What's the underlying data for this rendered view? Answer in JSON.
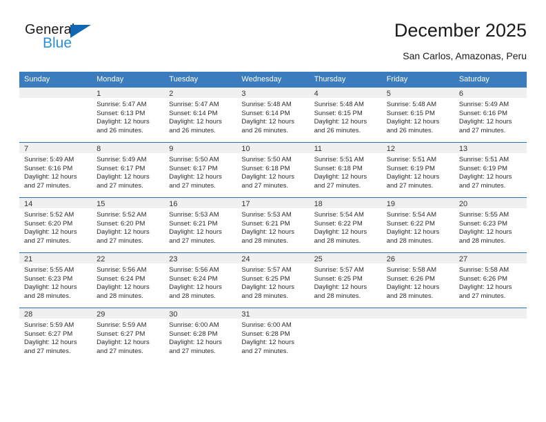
{
  "brand": {
    "name_top": "General",
    "name_bottom": "Blue",
    "triangle_color": "#1267b2",
    "blue_text_color": "#2a8fd4"
  },
  "header": {
    "title": "December 2025",
    "subtitle": "San Carlos, Amazonas, Peru"
  },
  "theme": {
    "header_bg": "#3a7cbe",
    "header_text": "#ffffff",
    "daynum_band_bg": "#f0f0f0",
    "row_divider": "#2c6ca8"
  },
  "weekday_headers": [
    "Sunday",
    "Monday",
    "Tuesday",
    "Wednesday",
    "Thursday",
    "Friday",
    "Saturday"
  ],
  "labels": {
    "sunrise_prefix": "Sunrise:",
    "sunset_prefix": "Sunset:",
    "daylight_prefix": "Daylight:"
  },
  "weeks": [
    [
      {
        "day": "",
        "empty": true,
        "line1": "",
        "line2": "",
        "line3": "",
        "line4": ""
      },
      {
        "day": "1",
        "empty": false,
        "line1": "Sunrise: 5:47 AM",
        "line2": "Sunset: 6:13 PM",
        "line3": "Daylight: 12 hours",
        "line4": "and 26 minutes."
      },
      {
        "day": "2",
        "empty": false,
        "line1": "Sunrise: 5:47 AM",
        "line2": "Sunset: 6:14 PM",
        "line3": "Daylight: 12 hours",
        "line4": "and 26 minutes."
      },
      {
        "day": "3",
        "empty": false,
        "line1": "Sunrise: 5:48 AM",
        "line2": "Sunset: 6:14 PM",
        "line3": "Daylight: 12 hours",
        "line4": "and 26 minutes."
      },
      {
        "day": "4",
        "empty": false,
        "line1": "Sunrise: 5:48 AM",
        "line2": "Sunset: 6:15 PM",
        "line3": "Daylight: 12 hours",
        "line4": "and 26 minutes."
      },
      {
        "day": "5",
        "empty": false,
        "line1": "Sunrise: 5:48 AM",
        "line2": "Sunset: 6:15 PM",
        "line3": "Daylight: 12 hours",
        "line4": "and 26 minutes."
      },
      {
        "day": "6",
        "empty": false,
        "line1": "Sunrise: 5:49 AM",
        "line2": "Sunset: 6:16 PM",
        "line3": "Daylight: 12 hours",
        "line4": "and 27 minutes."
      }
    ],
    [
      {
        "day": "7",
        "empty": false,
        "line1": "Sunrise: 5:49 AM",
        "line2": "Sunset: 6:16 PM",
        "line3": "Daylight: 12 hours",
        "line4": "and 27 minutes."
      },
      {
        "day": "8",
        "empty": false,
        "line1": "Sunrise: 5:49 AM",
        "line2": "Sunset: 6:17 PM",
        "line3": "Daylight: 12 hours",
        "line4": "and 27 minutes."
      },
      {
        "day": "9",
        "empty": false,
        "line1": "Sunrise: 5:50 AM",
        "line2": "Sunset: 6:17 PM",
        "line3": "Daylight: 12 hours",
        "line4": "and 27 minutes."
      },
      {
        "day": "10",
        "empty": false,
        "line1": "Sunrise: 5:50 AM",
        "line2": "Sunset: 6:18 PM",
        "line3": "Daylight: 12 hours",
        "line4": "and 27 minutes."
      },
      {
        "day": "11",
        "empty": false,
        "line1": "Sunrise: 5:51 AM",
        "line2": "Sunset: 6:18 PM",
        "line3": "Daylight: 12 hours",
        "line4": "and 27 minutes."
      },
      {
        "day": "12",
        "empty": false,
        "line1": "Sunrise: 5:51 AM",
        "line2": "Sunset: 6:19 PM",
        "line3": "Daylight: 12 hours",
        "line4": "and 27 minutes."
      },
      {
        "day": "13",
        "empty": false,
        "line1": "Sunrise: 5:51 AM",
        "line2": "Sunset: 6:19 PM",
        "line3": "Daylight: 12 hours",
        "line4": "and 27 minutes."
      }
    ],
    [
      {
        "day": "14",
        "empty": false,
        "line1": "Sunrise: 5:52 AM",
        "line2": "Sunset: 6:20 PM",
        "line3": "Daylight: 12 hours",
        "line4": "and 27 minutes."
      },
      {
        "day": "15",
        "empty": false,
        "line1": "Sunrise: 5:52 AM",
        "line2": "Sunset: 6:20 PM",
        "line3": "Daylight: 12 hours",
        "line4": "and 27 minutes."
      },
      {
        "day": "16",
        "empty": false,
        "line1": "Sunrise: 5:53 AM",
        "line2": "Sunset: 6:21 PM",
        "line3": "Daylight: 12 hours",
        "line4": "and 27 minutes."
      },
      {
        "day": "17",
        "empty": false,
        "line1": "Sunrise: 5:53 AM",
        "line2": "Sunset: 6:21 PM",
        "line3": "Daylight: 12 hours",
        "line4": "and 28 minutes."
      },
      {
        "day": "18",
        "empty": false,
        "line1": "Sunrise: 5:54 AM",
        "line2": "Sunset: 6:22 PM",
        "line3": "Daylight: 12 hours",
        "line4": "and 28 minutes."
      },
      {
        "day": "19",
        "empty": false,
        "line1": "Sunrise: 5:54 AM",
        "line2": "Sunset: 6:22 PM",
        "line3": "Daylight: 12 hours",
        "line4": "and 28 minutes."
      },
      {
        "day": "20",
        "empty": false,
        "line1": "Sunrise: 5:55 AM",
        "line2": "Sunset: 6:23 PM",
        "line3": "Daylight: 12 hours",
        "line4": "and 28 minutes."
      }
    ],
    [
      {
        "day": "21",
        "empty": false,
        "line1": "Sunrise: 5:55 AM",
        "line2": "Sunset: 6:23 PM",
        "line3": "Daylight: 12 hours",
        "line4": "and 28 minutes."
      },
      {
        "day": "22",
        "empty": false,
        "line1": "Sunrise: 5:56 AM",
        "line2": "Sunset: 6:24 PM",
        "line3": "Daylight: 12 hours",
        "line4": "and 28 minutes."
      },
      {
        "day": "23",
        "empty": false,
        "line1": "Sunrise: 5:56 AM",
        "line2": "Sunset: 6:24 PM",
        "line3": "Daylight: 12 hours",
        "line4": "and 28 minutes."
      },
      {
        "day": "24",
        "empty": false,
        "line1": "Sunrise: 5:57 AM",
        "line2": "Sunset: 6:25 PM",
        "line3": "Daylight: 12 hours",
        "line4": "and 28 minutes."
      },
      {
        "day": "25",
        "empty": false,
        "line1": "Sunrise: 5:57 AM",
        "line2": "Sunset: 6:25 PM",
        "line3": "Daylight: 12 hours",
        "line4": "and 28 minutes."
      },
      {
        "day": "26",
        "empty": false,
        "line1": "Sunrise: 5:58 AM",
        "line2": "Sunset: 6:26 PM",
        "line3": "Daylight: 12 hours",
        "line4": "and 28 minutes."
      },
      {
        "day": "27",
        "empty": false,
        "line1": "Sunrise: 5:58 AM",
        "line2": "Sunset: 6:26 PM",
        "line3": "Daylight: 12 hours",
        "line4": "and 27 minutes."
      }
    ],
    [
      {
        "day": "28",
        "empty": false,
        "line1": "Sunrise: 5:59 AM",
        "line2": "Sunset: 6:27 PM",
        "line3": "Daylight: 12 hours",
        "line4": "and 27 minutes."
      },
      {
        "day": "29",
        "empty": false,
        "line1": "Sunrise: 5:59 AM",
        "line2": "Sunset: 6:27 PM",
        "line3": "Daylight: 12 hours",
        "line4": "and 27 minutes."
      },
      {
        "day": "30",
        "empty": false,
        "line1": "Sunrise: 6:00 AM",
        "line2": "Sunset: 6:28 PM",
        "line3": "Daylight: 12 hours",
        "line4": "and 27 minutes."
      },
      {
        "day": "31",
        "empty": false,
        "line1": "Sunrise: 6:00 AM",
        "line2": "Sunset: 6:28 PM",
        "line3": "Daylight: 12 hours",
        "line4": "and 27 minutes."
      },
      {
        "day": "",
        "empty": true,
        "line1": "",
        "line2": "",
        "line3": "",
        "line4": ""
      },
      {
        "day": "",
        "empty": true,
        "line1": "",
        "line2": "",
        "line3": "",
        "line4": ""
      },
      {
        "day": "",
        "empty": true,
        "line1": "",
        "line2": "",
        "line3": "",
        "line4": ""
      }
    ]
  ]
}
